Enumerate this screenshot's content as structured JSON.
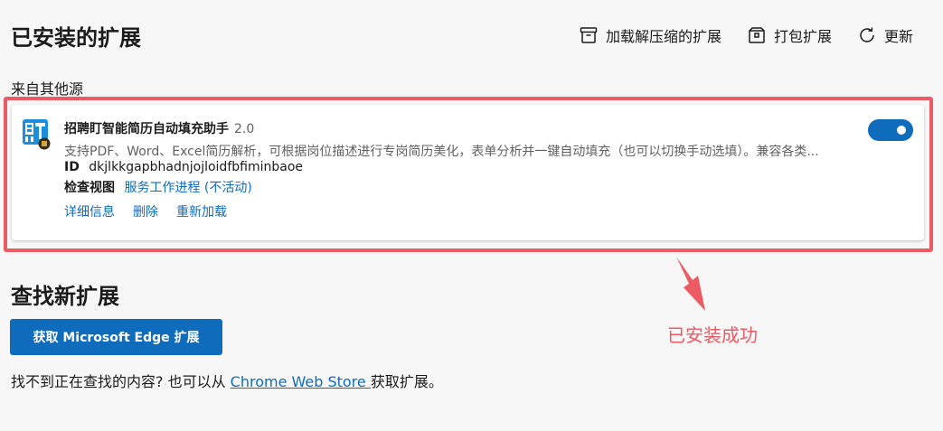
{
  "header": {
    "title": "已安装的扩展",
    "toolbar": {
      "load_unpacked": "加载解压缩的扩展",
      "pack": "打包扩展",
      "update": "更新"
    }
  },
  "section": {
    "other_sources": "来自其他源"
  },
  "extension": {
    "name": "招聘盯智能简历自动填充助手",
    "version": "2.0",
    "description": "支持PDF、Word、Excel简历解析，可根据岗位描述进行专岗简历美化，表单分析并一键自动填充（也可以切换手动选填）。兼容各类...",
    "id_label": "ID",
    "id_value": "dkjlkkgapbhadnjojloidfbfiminbaoe",
    "inspect_label": "检查视图",
    "inspect_link": "服务工作进程 (不活动)",
    "actions": {
      "details": "详细信息",
      "remove": "删除",
      "reload": "重新加载"
    },
    "enabled": true,
    "icon": "resume-app-icon"
  },
  "find": {
    "title": "查找新扩展",
    "button": "获取 Microsoft Edge 扩展",
    "text_before": "找不到正在查找的内容? 也可以从 ",
    "store_link": "Chrome Web Store ",
    "text_after": "获取扩展。"
  },
  "annotation": {
    "text": "已安装成功",
    "color": "#ec5a64"
  },
  "colors": {
    "accent": "#0f6cbd",
    "highlight": "#ec5a64"
  }
}
